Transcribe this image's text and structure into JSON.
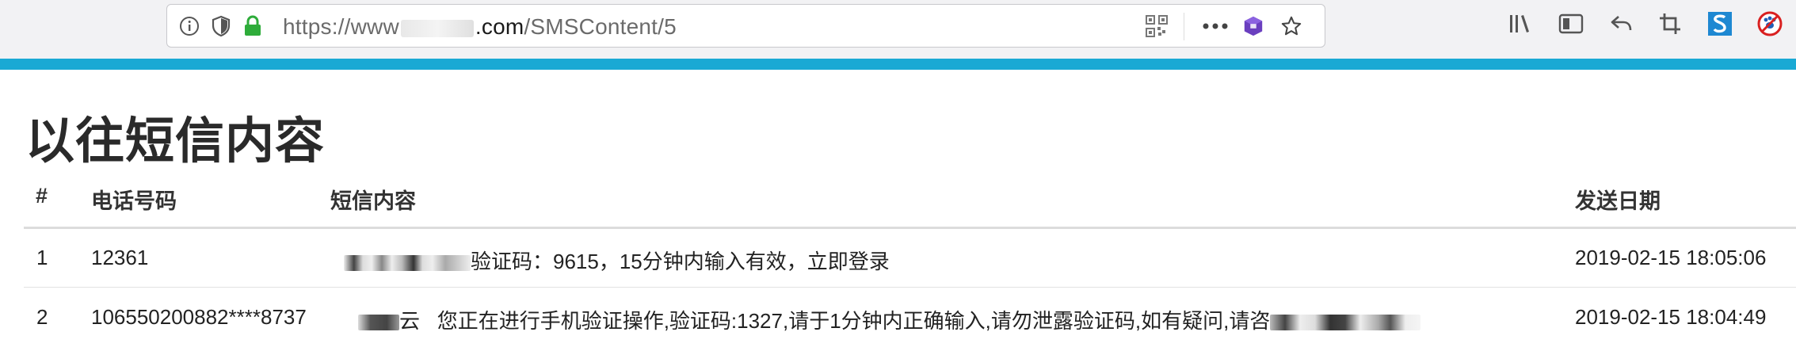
{
  "browser": {
    "url_prefix": "https://www",
    "url_domain": ".com",
    "url_path": "/SMSContent/5"
  },
  "page": {
    "title": "以往短信内容"
  },
  "table": {
    "headers": {
      "index": "#",
      "phone": "电话号码",
      "content": "短信内容",
      "date": "发送日期"
    },
    "rows": [
      {
        "index": "1",
        "phone": "12361",
        "content": "验证码：9615，15分钟内输入有效，立即登录",
        "date": "2019-02-15 18:05:06"
      },
      {
        "index": "2",
        "phone": "106550200882****8737",
        "content_prefix": "云",
        "content": "您正在进行手机验证操作,验证码:1327,请于1分钟内正确输入,请勿泄露验证码,如有疑问,请咨",
        "date": "2019-02-15 18:04:49"
      }
    ]
  },
  "colors": {
    "accent": "#1aa9d4",
    "lock_green": "#2eac3a"
  }
}
